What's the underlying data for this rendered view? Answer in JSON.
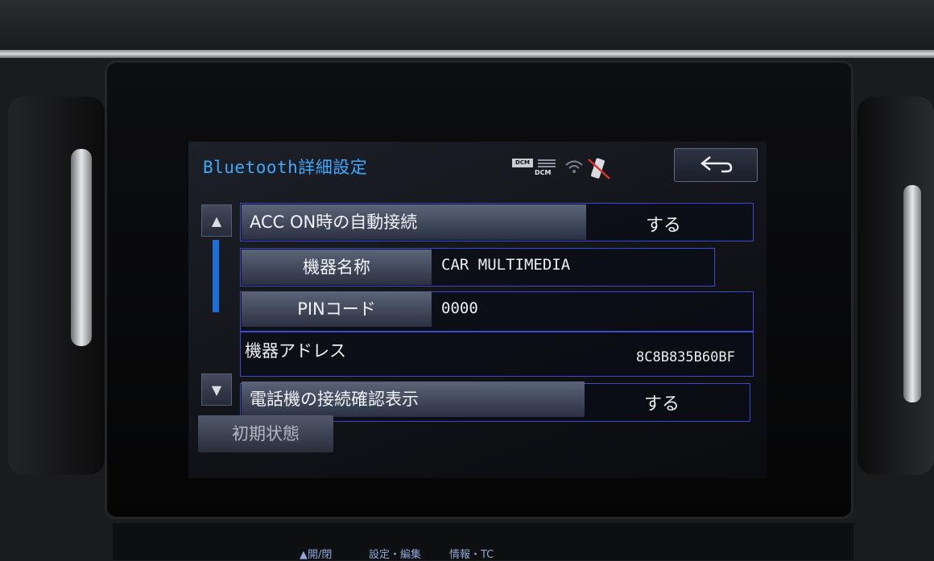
{
  "header": {
    "title": "Bluetooth詳細設定",
    "status": {
      "dcm_badge": "DCM",
      "dcm_label": "DCM"
    }
  },
  "settings": [
    {
      "label": "ACC ON時の自動接続",
      "value": "する"
    },
    {
      "label": "機器名称",
      "value": "CAR MULTIMEDIA"
    },
    {
      "label": "PINコード",
      "value": "0000"
    },
    {
      "label": "機器アドレス",
      "value": "8C8B835B60BF"
    },
    {
      "label": "電話機の接続確認表示",
      "value": "する"
    }
  ],
  "reset_label": "初期状態",
  "physical_buttons": [
    "▲開/閉",
    "設定・編集",
    "情報・TC"
  ],
  "icons": {
    "back": "back-arrow-icon",
    "scroll_up": "scroll-up-icon",
    "scroll_down": "scroll-down-icon",
    "wifi": "wifi-icon",
    "phone": "phone-disconnected-icon"
  },
  "colors": {
    "title": "#3fa8ff",
    "accent_border": "#3a4bd1",
    "scroll_indicator": "#1b6fd6"
  }
}
